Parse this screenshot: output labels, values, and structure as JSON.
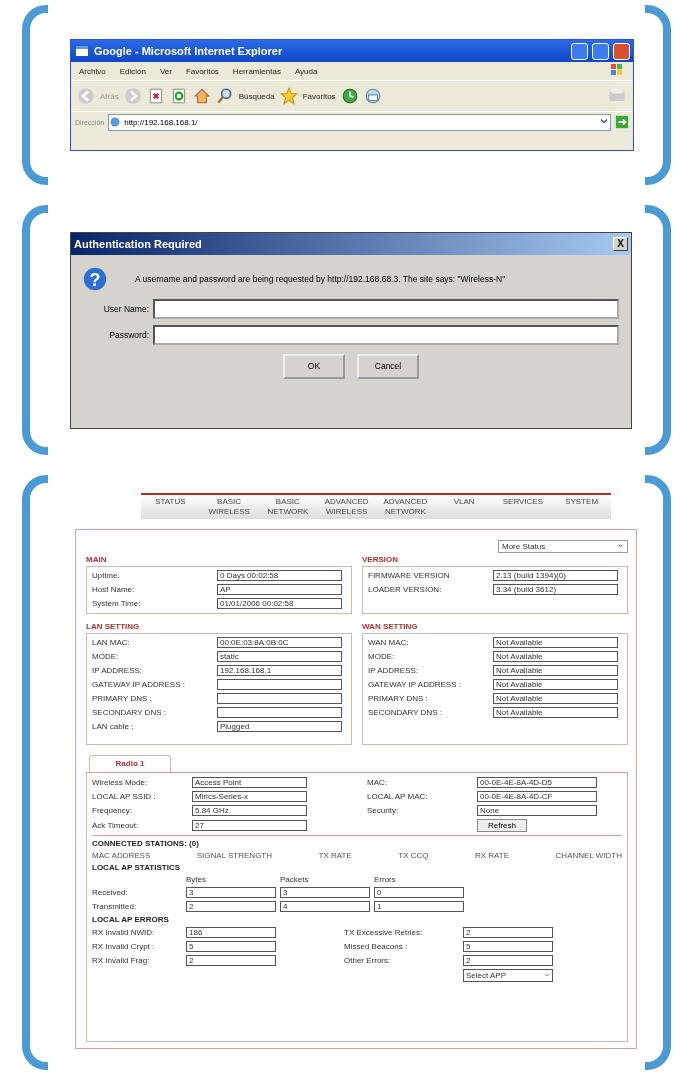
{
  "browser": {
    "title": "Google - Microsoft Internet Explorer",
    "menu": [
      "Archivo",
      "Edición",
      "Ver",
      "Favoritos",
      "Herramientas",
      "Ayuda"
    ],
    "back": "Atrás",
    "search": "Búsqueda",
    "favorites": "Favoritos",
    "address_label": "Dirección",
    "address": "http://192.168.168.1/"
  },
  "auth_dialog": {
    "title": "Authentication Required",
    "close": "X",
    "icon": "?",
    "message": "A username and password are being requested by http://192.168.68.3. The site says: \"Wireless-N\"",
    "fields": [
      {
        "label": "User Name:"
      },
      {
        "label": "Password:"
      }
    ],
    "buttons": [
      "OK",
      "Cancel"
    ]
  },
  "router": {
    "nav": [
      "STATUS",
      "BASIC WIRELESS",
      "BASIC NETWORK",
      "ADVANCED WIRELESS",
      "ADVANCED NETWORK",
      "VLAN",
      "SERVICES",
      "SYSTEM"
    ],
    "status_select": "More Status",
    "boxes": [
      {
        "title": "MAIN",
        "rows": [
          {
            "label": "Uptime:",
            "value": "0 Days 00:02:58"
          },
          {
            "label": "Host Name:",
            "value": "AP"
          },
          {
            "label": "System Time:",
            "value": "01/01/2006 00:02:58"
          }
        ]
      },
      {
        "title": "VERSION",
        "rows": [
          {
            "label": "FIRMWARE VERSION",
            "value": "2.13 (build 1394)(0)"
          },
          {
            "label": "LOADER VERSION:",
            "value": "3.34 (build 3612)"
          }
        ]
      },
      {
        "title": "LAN SETTING",
        "rows": [
          {
            "label": "LAN MAC:",
            "value": "00:0E:03:8A:0B:0C"
          },
          {
            "label": "MODE:",
            "value": "static"
          },
          {
            "label": "IP ADDRESS:",
            "value": "192.168.168.1"
          },
          {
            "label": "GATEWAY IP ADDRESS :",
            "value": ""
          },
          {
            "label": "PRIMARY DNS :",
            "value": ""
          },
          {
            "label": "SECONDARY DNS :",
            "value": ""
          },
          {
            "label": "LAN cable :",
            "value": "Plugged"
          }
        ]
      },
      {
        "title": "WAN SETTING",
        "rows": [
          {
            "label": "WAN MAC:",
            "value": "Not Available"
          },
          {
            "label": "MODE:",
            "value": "Not Available"
          },
          {
            "label": "IP ADDRESS:",
            "value": "Not Available"
          },
          {
            "label": "GATEWAY IP ADDRESS :",
            "value": "Not Available"
          },
          {
            "label": "PRIMARY DNS :",
            "value": "Not Available"
          },
          {
            "label": "SECONDARY DNS :",
            "value": "Not Available"
          }
        ]
      }
    ],
    "radio": {
      "tab": "Radio 1",
      "left": [
        {
          "label": "Wireless Mode:",
          "value": "Access Point"
        },
        {
          "label": "LOCAL AP SSID :",
          "value": "Mirics-Series-x"
        },
        {
          "label": "Frequency:",
          "value": "5.84 GHz"
        },
        {
          "label": "Ack Timeout:",
          "value": "27"
        }
      ],
      "right": [
        {
          "label": "MAC:",
          "value": "00-0E-4E-8A-4D-D5"
        },
        {
          "label": "LOCAL AP MAC:",
          "value": "00-0E-4E-8A-4D-CF"
        },
        {
          "label": "Security:",
          "value": "None"
        }
      ],
      "refresh": "Refresh",
      "stations_title": "CONNECTED STATIONS: (0)",
      "station_columns": [
        "MAC ADDRESS",
        "SIGNAL STRENGTH",
        "TX RATE",
        "TX CCQ",
        "RX RATE",
        "CHANNEL WIDTH"
      ],
      "stats_title": "LOCAL AP STATISTICS",
      "stats_columns": [
        "Bytes",
        "Packets",
        "Errors"
      ],
      "stats_rows": [
        {
          "label": "Received:",
          "values": [
            "3",
            "3",
            "0"
          ]
        },
        {
          "label": "Transmitted:",
          "values": [
            "2",
            "4",
            "1"
          ]
        }
      ],
      "errors_title": "LOCAL AP ERRORS",
      "errors_left": [
        {
          "label": "RX Invalid NWID:",
          "value": "186"
        },
        {
          "label": "RX Invalid Crypt :",
          "value": "5"
        },
        {
          "label": "RX Invalid Frag:",
          "value": "2"
        }
      ],
      "errors_right": [
        {
          "label": "TX Excessive Retries:",
          "value": "2"
        },
        {
          "label": "Missed Beacons :",
          "value": "5"
        },
        {
          "label": "Other Errors:",
          "value": "2"
        }
      ],
      "select": "Select APP"
    }
  }
}
